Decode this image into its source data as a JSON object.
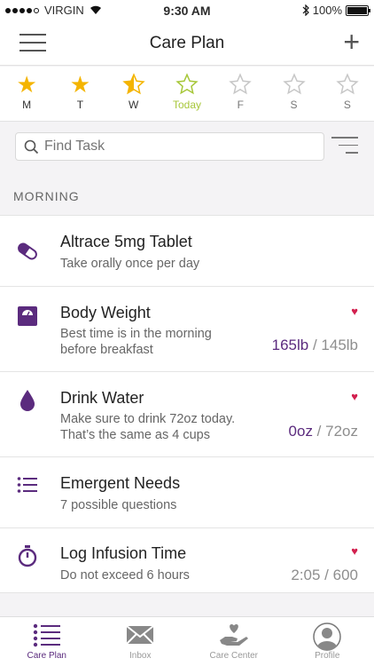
{
  "status": {
    "carrier": "VIRGIN",
    "time": "9:30 AM",
    "battery": "100%"
  },
  "nav": {
    "title": "Care Plan"
  },
  "week": [
    {
      "label": "M",
      "rating": "full"
    },
    {
      "label": "T",
      "rating": "full"
    },
    {
      "label": "W",
      "rating": "half"
    },
    {
      "label": "Today",
      "rating": "today"
    },
    {
      "label": "F",
      "rating": "empty"
    },
    {
      "label": "S",
      "rating": "empty"
    },
    {
      "label": "S",
      "rating": "empty"
    }
  ],
  "search": {
    "placeholder": "Find Task"
  },
  "section": "MORNING",
  "tasks": [
    {
      "title": "Altrace 5mg Tablet",
      "sub1": "Take orally once per day",
      "icon": "pill-icon"
    },
    {
      "title": "Body Weight",
      "sub1": "Best time is in the morning",
      "sub2": "before breakfast",
      "current": "165lb",
      "target": " / 145lb",
      "favorite": true,
      "icon": "scale-icon"
    },
    {
      "title": "Drink Water",
      "sub1": "Make sure to drink 72oz today.",
      "sub2": "That’s the same as 4 cups",
      "current": "0oz",
      "target": " / 72oz",
      "favorite": true,
      "icon": "water-drop-icon"
    },
    {
      "title": "Emergent Needs",
      "sub1": "7 possible questions",
      "icon": "list-icon"
    },
    {
      "title": "Log Infusion Time",
      "sub1": "Do not exceed 6 hours",
      "value": "2:05 / 600",
      "favorite": true,
      "icon": "timer-icon"
    }
  ],
  "tabs": [
    {
      "label": "Care Plan",
      "icon": "list-icon",
      "active": true
    },
    {
      "label": "Inbox",
      "icon": "envelope-icon"
    },
    {
      "label": "Care Center",
      "icon": "hand-heart-icon"
    },
    {
      "label": "Profile",
      "icon": "user-avatar-icon"
    }
  ],
  "colors": {
    "accent": "#5b2b7e",
    "star": "#f4b400",
    "today": "#a7c73a",
    "heart": "#d21f4e"
  }
}
